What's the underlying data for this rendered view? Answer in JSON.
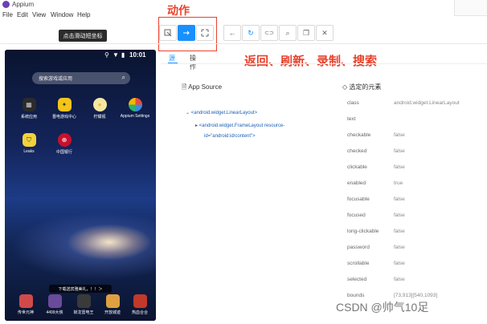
{
  "window": {
    "title": "Appium"
  },
  "menu": [
    "File",
    "Edit",
    "View",
    "Window",
    "Help"
  ],
  "annotations": {
    "actions": "动作",
    "toolbar_desc": "返回、刷新、录制、搜索"
  },
  "tooltip": "点击滑动短坐标",
  "toolbar": {
    "action_icons": [
      "select-element-icon",
      "swipe-arrow-icon",
      "tap-coordinates-icon"
    ],
    "nav_icons": [
      "back-arrow-icon",
      "refresh-icon",
      "record-icon",
      "search-icon",
      "copy-xml-icon",
      "close-icon"
    ],
    "nav_glyphs": [
      "←",
      "↻",
      "⊂⊃",
      "⌕",
      "❐",
      "✕"
    ]
  },
  "device": {
    "time": "10:01",
    "search_placeholder": "搜索游戏或应用",
    "apps": [
      {
        "label": "系统应用",
        "color": "#2b2b2b",
        "glyph": "▦"
      },
      {
        "label": "晋电游戏中心",
        "color": "#f5c518",
        "glyph": "🎮"
      },
      {
        "label": "柠檬视",
        "color": "#f5e7a1",
        "glyph": "●"
      },
      {
        "label": "Appium Settings",
        "color": "#e84d3d",
        "glyph": "◐"
      },
      {
        "label": "Leaks",
        "color": "#f2d23c",
        "glyph": "⛉"
      },
      {
        "label": "中国银行",
        "color": "#c8102e",
        "glyph": "⊕"
      }
    ],
    "banner": "下载送宾雅美礼，！！＞",
    "dock": [
      {
        "label": "传世元神",
        "color": "#d04a4a"
      },
      {
        "label": "4499大侠",
        "color": "#6a4a9a"
      },
      {
        "label": "斩龙雷电王",
        "color": "#3a3a3a"
      },
      {
        "label": "开放城迹",
        "color": "#e0a040"
      },
      {
        "label": "热血合合",
        "color": "#c0392b"
      }
    ]
  },
  "inspector": {
    "tabs": [
      "源",
      "操作"
    ],
    "source_title": "App Source",
    "tree": [
      "<android.widget.LinearLayout>",
      "<android.widget.FrameLayout resource-",
      "id=\"android:id/content\">"
    ],
    "selected_title": "选定的元素",
    "attributes": [
      [
        "class",
        "android.widget.LinearLayout"
      ],
      [
        "text",
        ""
      ],
      [
        "checkable",
        "false"
      ],
      [
        "checked",
        "false"
      ],
      [
        "clickable",
        "false"
      ],
      [
        "enabled",
        "true"
      ],
      [
        "focusable",
        "false"
      ],
      [
        "focused",
        "false"
      ],
      [
        "long-clickable",
        "false"
      ],
      [
        "password",
        "false"
      ],
      [
        "scrollable",
        "false"
      ],
      [
        "selected",
        "false"
      ],
      [
        "bounds",
        "[73,913][540,1093]"
      ]
    ]
  },
  "watermark": "CSDN @帅气10足"
}
